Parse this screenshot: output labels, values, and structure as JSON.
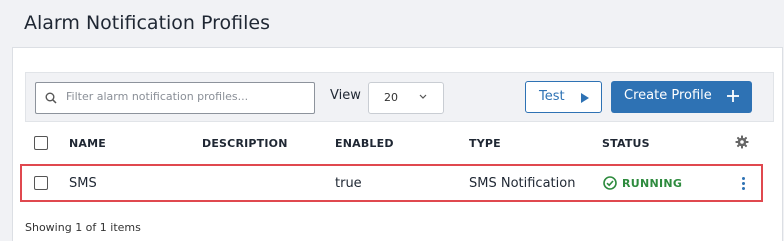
{
  "page": {
    "title": "Alarm Notification Profiles"
  },
  "toolbar": {
    "search_placeholder": "Filter alarm notification profiles...",
    "view_label": "View",
    "view_value": "20",
    "test_label": "Test",
    "create_label": "Create Profile"
  },
  "table": {
    "columns": [
      "NAME",
      "DESCRIPTION",
      "ENABLED",
      "TYPE",
      "STATUS"
    ],
    "rows": [
      {
        "name": "SMS",
        "description": "",
        "enabled": "true",
        "type": "SMS Notification",
        "status": "RUNNING"
      }
    ]
  },
  "footer": {
    "text": "Showing 1 of 1 items"
  },
  "colors": {
    "accent": "#2e72b4",
    "status_running": "#2e8b3e",
    "highlight": "#e0484f"
  },
  "icons": [
    "search-icon",
    "chevron-down-icon",
    "play-icon",
    "plus-icon",
    "gear-icon",
    "check-circle-icon",
    "kebab-menu-icon"
  ]
}
